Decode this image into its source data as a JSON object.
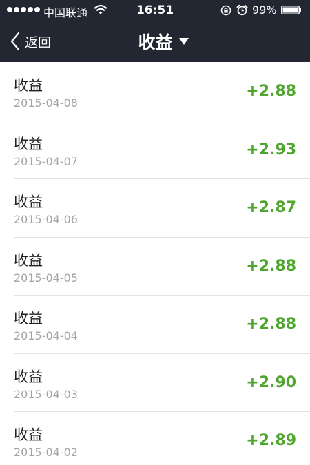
{
  "status_bar": {
    "carrier": "中国联通",
    "time": "16:51",
    "battery_percent": "99%",
    "icons": [
      "signal-dots",
      "wifi-icon",
      "rotation-lock-icon",
      "alarm-icon",
      "battery-icon"
    ]
  },
  "nav": {
    "back_label": "返回",
    "title": "收益",
    "back_icon": "chevron-left-icon",
    "dropdown_icon": "caret-down-icon"
  },
  "entries": [
    {
      "title": "收益",
      "date": "2015-04-08",
      "amount": "+2.88"
    },
    {
      "title": "收益",
      "date": "2015-04-07",
      "amount": "+2.93"
    },
    {
      "title": "收益",
      "date": "2015-04-06",
      "amount": "+2.87"
    },
    {
      "title": "收益",
      "date": "2015-04-05",
      "amount": "+2.88"
    },
    {
      "title": "收益",
      "date": "2015-04-04",
      "amount": "+2.88"
    },
    {
      "title": "收益",
      "date": "2015-04-03",
      "amount": "+2.90"
    },
    {
      "title": "收益",
      "date": "2015-04-02",
      "amount": "+2.89"
    }
  ],
  "colors": {
    "header_bg": "#232731",
    "amount_green": "#4fa52d",
    "date_gray": "#a5a5a5",
    "divider": "#e3e3e3"
  }
}
